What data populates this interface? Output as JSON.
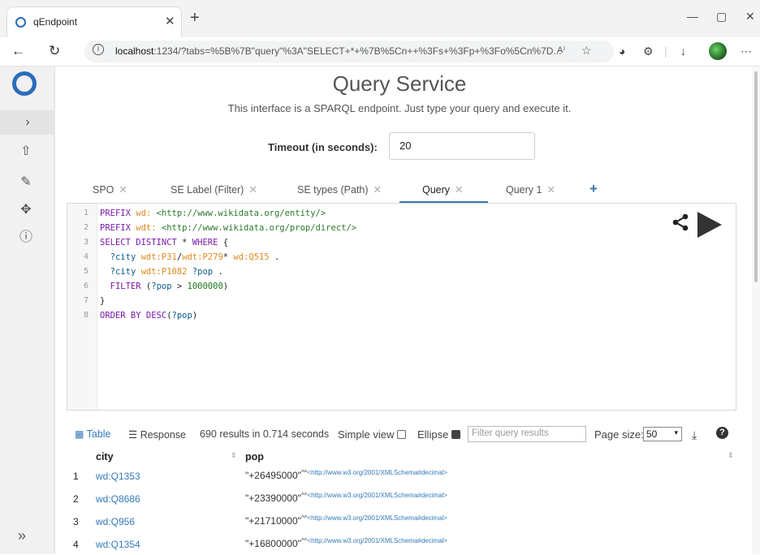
{
  "browser": {
    "tab_title": "qEndpoint",
    "url_host": "localhost",
    "url_rest": ":1234/?tabs=%5B%7B\"query\"%3A\"SELECT+*+%7B%5Cn++%3Fs+%3Fp+%3Fo%5Cn%7D...",
    "reader_label": "A⁾"
  },
  "header": {
    "title": "Query Service",
    "subtitle": "This interface is a SPARQL endpoint. Just type your query and execute it."
  },
  "timeout": {
    "label": "Timeout (in seconds):",
    "value": "20"
  },
  "tabs": [
    {
      "label": "SPO",
      "active": false
    },
    {
      "label": "SE Label (Filter)",
      "active": false
    },
    {
      "label": "SE types (Path)",
      "active": false
    },
    {
      "label": "Query",
      "active": true
    },
    {
      "label": "Query 1",
      "active": false
    }
  ],
  "editor": {
    "lines": [
      "PREFIX wd: <http://www.wikidata.org/entity/>",
      "PREFIX wdt: <http://www.wikidata.org/prop/direct/>",
      "SELECT DISTINCT * WHERE {",
      "  ?city wdt:P31/wdt:P279* wd:Q515 .",
      "  ?city wdt:P1082 ?pop .",
      "  FILTER (?pop > 1000000)",
      "}",
      "ORDER BY DESC(?pop)"
    ]
  },
  "results": {
    "table_label": "Table",
    "response_label": "Response",
    "summary": "690 results in 0.714 seconds",
    "simple_view_label": "Simple view",
    "simple_view_checked": false,
    "ellipse_label": "Ellipse",
    "ellipse_checked": true,
    "filter_placeholder": "Filter query results",
    "page_size_label": "Page size:",
    "page_size": "50",
    "columns": [
      "city",
      "pop"
    ],
    "rows": [
      {
        "idx": "1",
        "city": "wd:Q1353",
        "pop": "\"+26495000\"",
        "caret": "^^",
        "dtype": "<http://www.w3.org/2001/XMLSchema#decimal>"
      },
      {
        "idx": "2",
        "city": "wd:Q8686",
        "pop": "\"+23390000\"",
        "caret": "^^",
        "dtype": "<http://www.w3.org/2001/XMLSchema#decimal>"
      },
      {
        "idx": "3",
        "city": "wd:Q956",
        "pop": "\"+21710000\"",
        "caret": "^^",
        "dtype": "<http://www.w3.org/2001/XMLSchema#decimal>"
      },
      {
        "idx": "4",
        "city": "wd:Q1354",
        "pop": "\"+16800000\"",
        "caret": "^^",
        "dtype": "<http://www.w3.org/2001/XMLSchema#decimal>"
      }
    ]
  },
  "colors": {
    "accent": "#337ab7",
    "logo": "#2a6dbb"
  }
}
